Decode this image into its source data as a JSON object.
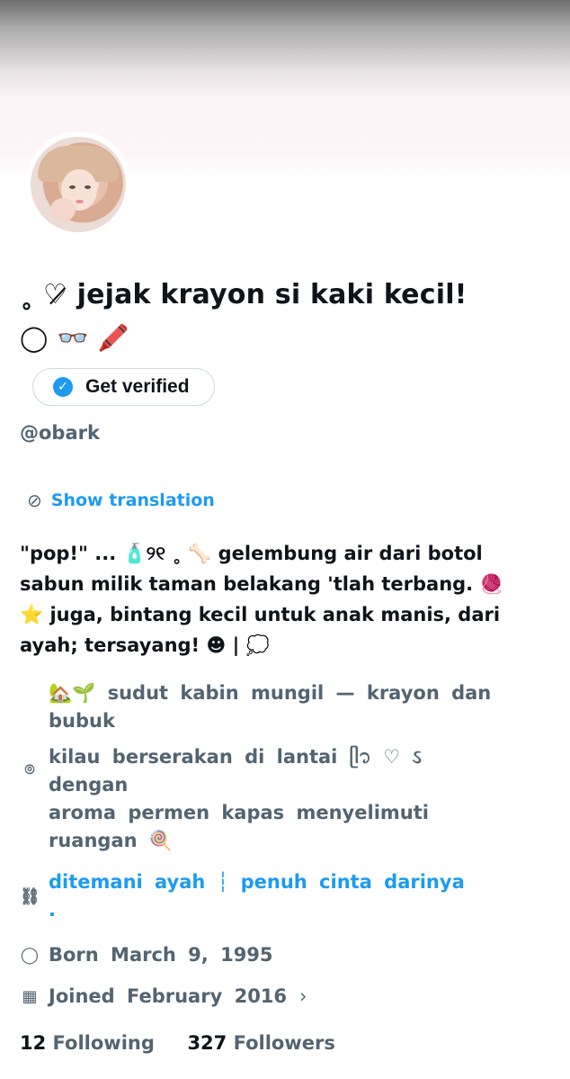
{
  "profile": {
    "display_name": "˳ ♡̷ jejak krayon si kaki kecil!",
    "display_name_line2": "◯ 👓 🖍️",
    "verify_label": "Get verified",
    "handle": "@obark",
    "translate_label": "Show translation",
    "bio": "\"pop!\" ... 🧴୨୧ ˳ 🦴 gelembung air dari botol\nsabun milik taman belakang 'tlah terbang. 🧶\n⭐ juga, bintang kecil untuk anak manis, dari\nayah; tersayang! ☻ | 💭",
    "location_line1": "🏡🌱 sudut kabin mungil — krayon dan\nbubuk",
    "location_line2": "kilau berserakan di lantai ᥫ᭡ ♡ ઽ\ndengan\naroma permen kapas menyelimuti\nruangan 🍭",
    "link_text": "ditemani ayah ┆ penuh cinta darinya\n.",
    "born": "Born March 9, 1995",
    "joined": "Joined February 2016",
    "following_count": "12",
    "following_label": "Following",
    "followers_count": "327",
    "followers_label": "Followers"
  },
  "icons": {
    "verified": "check-badge-icon",
    "translate": "globe-slash-icon",
    "location": "location-pin-icon",
    "link": "link-icon",
    "birthday": "balloon-icon",
    "calendar": "calendar-icon",
    "chevron": "chevron-right-icon"
  },
  "colors": {
    "accent": "#1d9bf0",
    "secondary_text": "#536471",
    "primary_text": "#0f1419"
  }
}
